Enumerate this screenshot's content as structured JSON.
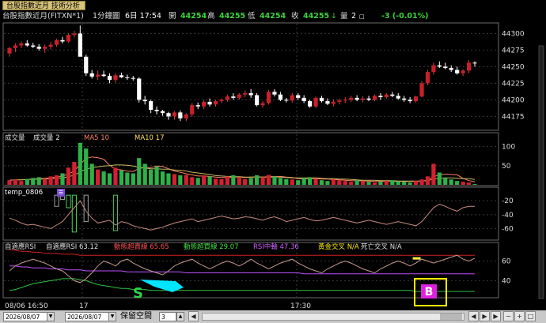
{
  "window": {
    "tab_label": "台股指數近月 技術分析"
  },
  "info": {
    "symbol": "台股指數近月(FITXN*1)",
    "interval": "1分鐘圖",
    "date_time_label": "6日 17:54",
    "open_label": "開",
    "open": "44254",
    "high_label": "高",
    "high": "44255",
    "low_label": "低",
    "low": "44254",
    "close_label": "收",
    "close": "44255",
    "close_arrow": "↓",
    "volume_label": "量",
    "volume": "2",
    "change": "-3 (-0.01%)"
  },
  "price_panel": {
    "y_ticks": [
      "44300",
      "44275",
      "44250",
      "44225",
      "44200",
      "44175"
    ]
  },
  "volume_panel": {
    "title": "成交量",
    "items": [
      {
        "label": "成交量 2",
        "color": "#e0e0e0"
      },
      {
        "label": "MA5 10",
        "color": "#ff8060"
      },
      {
        "label": "MA10 17",
        "color": "#ffe060"
      }
    ],
    "y_ticks": [
      "100",
      "50"
    ]
  },
  "temp_panel": {
    "title": "temp_0806",
    "y_ticks": [
      "-20",
      "-40",
      "-60"
    ]
  },
  "rsi_panel": {
    "title": "自適應RSI",
    "items": [
      {
        "label": "自適應RSI 63.12",
        "color": "#e0e0e0"
      },
      {
        "label": "動態超賣線 65.65",
        "color": "#ff5050"
      },
      {
        "label": "動態超買線 29.07",
        "color": "#40e040"
      },
      {
        "label": "RSI中軸 47.36",
        "color": "#d060ff"
      },
      {
        "label": "黃金交叉 N/A",
        "color": "#ffee00"
      },
      {
        "label": "死亡交叉 N/A",
        "color": "#e0e0e0"
      }
    ],
    "y_ticks": [
      "60",
      "40"
    ],
    "signal_s": "S",
    "signal_b": "B"
  },
  "time_axis": {
    "labels": [
      "08/06 16:50",
      "17",
      "17:30"
    ]
  },
  "bottom": {
    "date_from": "2026/08/07",
    "date_to": "2026/08/07",
    "reserve_label": "保留空間",
    "reserve_value": "3"
  },
  "chart_data": {
    "type": "candlestick",
    "price_ylim": [
      44160,
      44310
    ],
    "ohlc": [
      [
        44270,
        44280,
        44265,
        44278
      ],
      [
        44278,
        44285,
        44272,
        44282
      ],
      [
        44282,
        44288,
        44278,
        44285
      ],
      [
        44285,
        44290,
        44280,
        44282
      ],
      [
        44282,
        44286,
        44278,
        44280
      ],
      [
        44280,
        44284,
        44274,
        44277
      ],
      [
        44277,
        44283,
        44271,
        44280
      ],
      [
        44280,
        44287,
        44276,
        44283
      ],
      [
        44283,
        44292,
        44280,
        44290
      ],
      [
        44290,
        44295,
        44285,
        44288
      ],
      [
        44288,
        44300,
        44286,
        44298
      ],
      [
        44298,
        44304,
        44294,
        44300
      ],
      [
        44300,
        44312,
        44295,
        44265
      ],
      [
        44265,
        44268,
        44236,
        44240
      ],
      [
        44240,
        44245,
        44232,
        44235
      ],
      [
        44235,
        44244,
        44230,
        44238
      ],
      [
        44238,
        44244,
        44234,
        44236
      ],
      [
        44236,
        44240,
        44225,
        44230
      ],
      [
        44230,
        44240,
        44226,
        44237
      ],
      [
        44237,
        44241,
        44233,
        44234
      ],
      [
        44234,
        44238,
        44230,
        44233
      ],
      [
        44233,
        44236,
        44229,
        44232
      ],
      [
        44232,
        44234,
        44196,
        44200
      ],
      [
        44200,
        44206,
        44193,
        44198
      ],
      [
        44198,
        44200,
        44180,
        44185
      ],
      [
        44185,
        44190,
        44178,
        44183
      ],
      [
        44183,
        44185,
        44176,
        44180
      ],
      [
        44180,
        44182,
        44170,
        44175
      ],
      [
        44175,
        44183,
        44170,
        44181
      ],
      [
        44181,
        44184,
        44168,
        44172
      ],
      [
        44172,
        44180,
        44168,
        44178
      ],
      [
        44178,
        44195,
        44175,
        44192
      ],
      [
        44192,
        44196,
        44186,
        44190
      ],
      [
        44190,
        44200,
        44186,
        44197
      ],
      [
        44197,
        44202,
        44190,
        44193
      ],
      [
        44193,
        44200,
        44190,
        44198
      ],
      [
        44198,
        44202,
        44195,
        44200
      ],
      [
        44200,
        44208,
        44197,
        44205
      ],
      [
        44205,
        44210,
        44200,
        44203
      ],
      [
        44203,
        44210,
        44200,
        44208
      ],
      [
        44208,
        44214,
        44204,
        44210
      ],
      [
        44210,
        44216,
        44203,
        44207
      ],
      [
        44207,
        44210,
        44190,
        44192
      ],
      [
        44192,
        44198,
        44188,
        44195
      ],
      [
        44195,
        44215,
        44193,
        44212
      ],
      [
        44212,
        44216,
        44205,
        44208
      ],
      [
        44208,
        44212,
        44198,
        44200
      ],
      [
        44200,
        44203,
        44196,
        44199
      ],
      [
        44199,
        44210,
        44196,
        44207
      ],
      [
        44207,
        44210,
        44200,
        44203
      ],
      [
        44203,
        44207,
        44195,
        44198
      ],
      [
        44198,
        44200,
        44188,
        44190
      ],
      [
        44190,
        44205,
        44188,
        44203
      ],
      [
        44203,
        44206,
        44196,
        44198
      ],
      [
        44198,
        44202,
        44192,
        44194
      ],
      [
        44194,
        44200,
        44190,
        44197
      ],
      [
        44197,
        44202,
        44193,
        44199
      ],
      [
        44199,
        44204,
        44195,
        44200
      ],
      [
        44200,
        44206,
        44197,
        44203
      ],
      [
        44203,
        44207,
        44198,
        44200
      ],
      [
        44200,
        44205,
        44196,
        44202
      ],
      [
        44202,
        44206,
        44198,
        44200
      ],
      [
        44200,
        44208,
        44198,
        44206
      ],
      [
        44206,
        44210,
        44200,
        44204
      ],
      [
        44204,
        44210,
        44202,
        44208
      ],
      [
        44208,
        44212,
        44204,
        44206
      ],
      [
        44206,
        44210,
        44200,
        44202
      ],
      [
        44202,
        44206,
        44197,
        44200
      ],
      [
        44200,
        44204,
        44195,
        44198
      ],
      [
        44198,
        44206,
        44196,
        44205
      ],
      [
        44205,
        44228,
        44204,
        44225
      ],
      [
        44225,
        44245,
        44222,
        44242
      ],
      [
        44242,
        44256,
        44238,
        44252
      ],
      [
        44252,
        44258,
        44248,
        44250
      ],
      [
        44250,
        44256,
        44246,
        44248
      ],
      [
        44248,
        44252,
        44242,
        44245
      ],
      [
        44245,
        44250,
        44238,
        44240
      ],
      [
        44240,
        44246,
        44236,
        44244
      ],
      [
        44244,
        44260,
        44240,
        44256
      ],
      [
        44256,
        44258,
        44250,
        44255
      ]
    ],
    "volume_ylim": [
      0,
      120
    ],
    "volume": [
      12,
      14,
      10,
      15,
      18,
      20,
      16,
      22,
      25,
      30,
      45,
      60,
      110,
      95,
      55,
      40,
      35,
      30,
      45,
      38,
      32,
      30,
      70,
      55,
      40,
      48,
      35,
      30,
      28,
      25,
      26,
      20,
      18,
      25,
      22,
      16,
      15,
      22,
      25,
      20,
      15,
      18,
      25,
      20,
      26,
      22,
      18,
      15,
      14,
      12,
      18,
      20,
      16,
      12,
      10,
      14,
      12,
      10,
      8,
      12,
      10,
      8,
      6,
      8,
      10,
      12,
      9,
      8,
      6,
      10,
      14,
      22,
      55,
      32,
      18,
      14,
      10,
      8,
      6,
      2
    ],
    "volume_up": [
      true,
      true,
      true,
      false,
      false,
      false,
      true,
      true,
      true,
      false,
      true,
      true,
      false,
      false,
      false,
      true,
      false,
      false,
      true,
      false,
      false,
      false,
      false,
      false,
      false,
      false,
      false,
      false,
      true,
      false,
      true,
      true,
      false,
      true,
      false,
      true,
      true,
      true,
      false,
      true,
      true,
      false,
      false,
      true,
      true,
      false,
      false,
      false,
      true,
      false,
      false,
      false,
      true,
      false,
      false,
      true,
      true,
      true,
      true,
      false,
      true,
      false,
      true,
      false,
      true,
      false,
      false,
      false,
      false,
      true,
      true,
      true,
      true,
      false,
      false,
      false,
      false,
      true,
      true,
      false
    ],
    "volume_ma5": [
      12,
      13,
      13,
      14,
      15,
      16,
      17,
      18,
      20,
      23,
      28,
      36,
      54,
      69,
      73,
      71,
      67,
      51,
      41,
      39,
      36,
      35,
      43,
      45,
      45,
      49,
      48,
      42,
      36,
      33,
      29,
      26,
      23,
      23,
      22,
      20,
      19,
      19,
      20,
      20,
      19,
      20,
      21,
      20,
      21,
      22,
      22,
      20,
      19,
      16,
      15,
      16,
      16,
      15,
      15,
      14,
      13,
      12,
      11,
      11,
      10,
      10,
      9,
      9,
      9,
      9,
      9,
      9,
      9,
      9,
      10,
      12,
      21,
      26,
      28,
      27,
      26,
      17,
      11,
      8
    ],
    "volume_ma10": [
      12,
      13,
      13,
      14,
      14,
      15,
      15,
      16,
      17,
      18,
      21,
      25,
      34,
      41,
      45,
      47,
      49,
      50,
      52,
      52,
      51,
      49,
      46,
      44,
      42,
      42,
      41,
      41,
      39,
      38,
      36,
      33,
      31,
      29,
      27,
      24,
      23,
      22,
      21,
      21,
      20,
      20,
      20,
      20,
      20,
      20,
      20,
      19,
      18,
      18,
      18,
      18,
      18,
      17,
      16,
      16,
      15,
      15,
      14,
      13,
      12,
      12,
      12,
      11,
      11,
      11,
      10,
      10,
      10,
      10,
      10,
      11,
      15,
      17,
      18,
      18,
      17,
      16,
      16,
      14
    ],
    "temp_ylim": [
      -72,
      -5
    ],
    "temp": [
      -45,
      -48,
      -52,
      -55,
      -54,
      -56,
      -58,
      -60,
      -55,
      -50,
      -40,
      -30,
      -20,
      -35,
      -45,
      -52,
      -50,
      -48,
      -55,
      -50,
      -52,
      -56,
      -58,
      -60,
      -62,
      -60,
      -58,
      -55,
      -52,
      -50,
      -48,
      -46,
      -50,
      -48,
      -46,
      -44,
      -42,
      -44,
      -46,
      -45,
      -43,
      -44,
      -46,
      -48,
      -45,
      -43,
      -46,
      -50,
      -48,
      -46,
      -44,
      -47,
      -49,
      -48,
      -46,
      -44,
      -46,
      -48,
      -50,
      -52,
      -50,
      -48,
      -50,
      -52,
      -54,
      -52,
      -50,
      -52,
      -54,
      -56,
      -50,
      -40,
      -30,
      -25,
      -28,
      -32,
      -35,
      -30,
      -28,
      -28
    ],
    "temp_bars": [
      {
        "x": 8,
        "y1": -12,
        "y2": -28,
        "color": "#a0a0a0"
      },
      {
        "x": 9,
        "y1": -12,
        "y2": -18,
        "color": "#a0a0a0"
      },
      {
        "x": 10,
        "y1": -12,
        "y2": -30,
        "color": "#4ecb5c"
      },
      {
        "x": 11,
        "y1": -12,
        "y2": -65,
        "color": "#4ecb5c"
      },
      {
        "x": 13,
        "y1": -12,
        "y2": -50,
        "color": "#a0a0a0"
      },
      {
        "x": 18,
        "y1": -12,
        "y2": -63,
        "color": "#4ecb5c"
      }
    ],
    "rsi_ylim": [
      25,
      75
    ],
    "rsi": [
      50,
      55,
      58,
      60,
      62,
      60,
      58,
      55,
      52,
      50,
      45,
      40,
      38,
      42,
      48,
      55,
      60,
      58,
      55,
      60,
      62,
      58,
      55,
      52,
      50,
      48,
      46,
      50,
      55,
      58,
      60,
      62,
      58,
      55,
      52,
      55,
      58,
      60,
      58,
      55,
      58,
      62,
      58,
      55,
      52,
      55,
      58,
      60,
      62,
      58,
      55,
      52,
      50,
      48,
      52,
      55,
      58,
      60,
      58,
      55,
      52,
      50,
      48,
      52,
      55,
      58,
      60,
      58,
      55,
      58,
      62,
      60,
      58,
      60,
      62,
      64,
      66,
      62,
      60,
      63
    ],
    "rsi_oversold": [
      72,
      71,
      70,
      70,
      69,
      69,
      68,
      68,
      68,
      67,
      67,
      67,
      66,
      66,
      66,
      66,
      66,
      66,
      66,
      66,
      66,
      66,
      66,
      66,
      66,
      66,
      66,
      66,
      66,
      66,
      66,
      66,
      66,
      66,
      66,
      66,
      66,
      66,
      66,
      66,
      66,
      66,
      66,
      66,
      66,
      66,
      66,
      66,
      66,
      66,
      66,
      66,
      66,
      66,
      66,
      66,
      66,
      66,
      66,
      66,
      66,
      66,
      66,
      66,
      66,
      66,
      66,
      66,
      66,
      66,
      66,
      66,
      66,
      66,
      66,
      66,
      66,
      66,
      66,
      66
    ],
    "rsi_overbought": [
      30,
      31,
      33,
      35,
      37,
      38,
      39,
      40,
      41,
      42,
      42,
      42,
      41,
      40,
      38,
      36,
      35,
      34,
      33,
      32,
      32,
      31,
      31,
      31,
      30,
      30,
      30,
      30,
      30,
      30,
      30,
      30,
      30,
      30,
      30,
      30,
      30,
      30,
      30,
      30,
      30,
      30,
      30,
      30,
      30,
      30,
      30,
      30,
      30,
      30,
      30,
      30,
      30,
      30,
      30,
      30,
      30,
      30,
      30,
      30,
      30,
      30,
      30,
      30,
      30,
      30,
      30,
      30,
      30,
      29,
      29,
      29,
      29,
      29,
      29,
      29,
      29,
      29,
      29,
      29
    ],
    "rsi_mid": [
      55,
      55,
      54,
      54,
      53,
      53,
      53,
      52,
      52,
      52,
      51,
      51,
      51,
      50,
      50,
      50,
      50,
      50,
      50,
      50,
      49,
      49,
      49,
      49,
      49,
      49,
      49,
      49,
      49,
      49,
      48,
      48,
      48,
      48,
      48,
      48,
      48,
      48,
      48,
      48,
      48,
      48,
      48,
      48,
      48,
      48,
      48,
      48,
      48,
      48,
      47,
      47,
      47,
      47,
      47,
      47,
      47,
      47,
      47,
      47,
      47,
      47,
      47,
      47,
      47,
      47,
      47,
      47,
      47,
      47,
      47,
      47,
      47,
      47,
      47,
      47,
      47,
      47,
      47,
      47
    ]
  }
}
